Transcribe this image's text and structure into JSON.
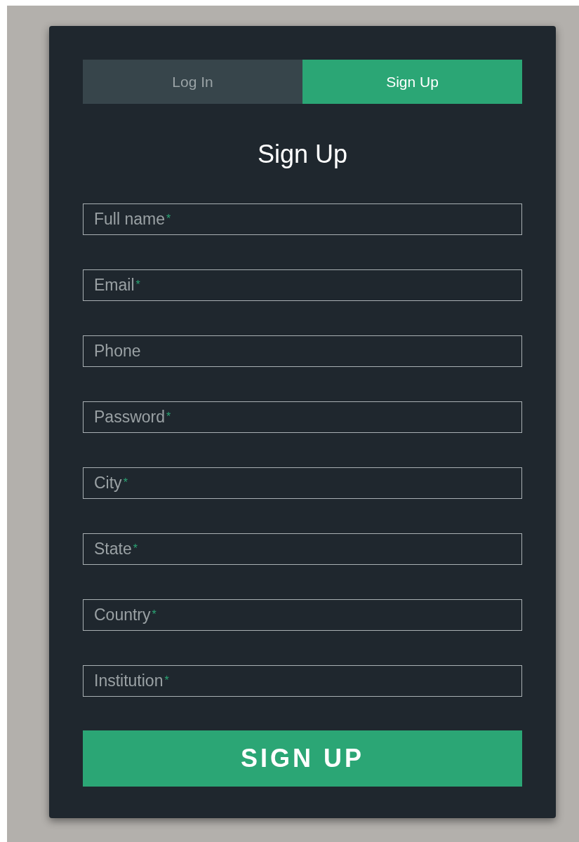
{
  "tabs": [
    {
      "label": "Log In",
      "selected": false
    },
    {
      "label": "Sign Up",
      "selected": true
    }
  ],
  "title": "Sign Up",
  "required_mark": "*",
  "fields": [
    {
      "label": "Full name",
      "required": true
    },
    {
      "label": "Email",
      "required": true
    },
    {
      "label": "Phone",
      "required": false
    },
    {
      "label": "Password",
      "required": true
    },
    {
      "label": "City",
      "required": true
    },
    {
      "label": "State",
      "required": true
    },
    {
      "label": "Country",
      "required": true
    },
    {
      "label": "Institution",
      "required": true
    }
  ],
  "submit_button": "SIGN UP"
}
